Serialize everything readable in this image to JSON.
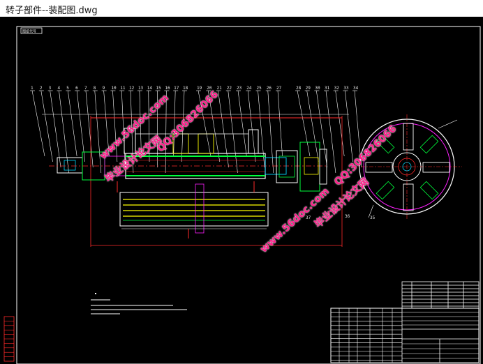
{
  "window": {
    "title": "转子部件--装配图.dwg"
  },
  "drawing": {
    "corner_tag": "图纸代号",
    "part_numbers_left": [
      "1",
      "2",
      "3",
      "4",
      "5",
      "6",
      "7",
      "8",
      "9",
      "10",
      "11",
      "12",
      "13",
      "14",
      "15",
      "16",
      "17",
      "18"
    ],
    "part_numbers_mid": [
      "19",
      "20",
      "21",
      "22",
      "23",
      "24",
      "25",
      "26",
      "27"
    ],
    "part_numbers_right": [
      "28",
      "29",
      "30",
      "31",
      "32",
      "33",
      "34"
    ],
    "callouts": [
      "36",
      "37",
      "35"
    ]
  },
  "watermarks": {
    "site_a": "www.56doc.com",
    "qq_a": "QQ:306826066",
    "brand_a": "毕业设计论文网",
    "site_b": "www.56doc.com",
    "qq_b": "QQ:306826066",
    "brand_b": "毕业设计论文网"
  },
  "colors": {
    "background": "#000000",
    "line_white": "#ffffff",
    "line_red": "#ff2a2a",
    "line_green": "#00ff3c",
    "line_yellow": "#ffff00",
    "line_cyan": "#00d8ff",
    "line_magenta": "#ff20ff",
    "watermark": "#ff1e8a"
  }
}
